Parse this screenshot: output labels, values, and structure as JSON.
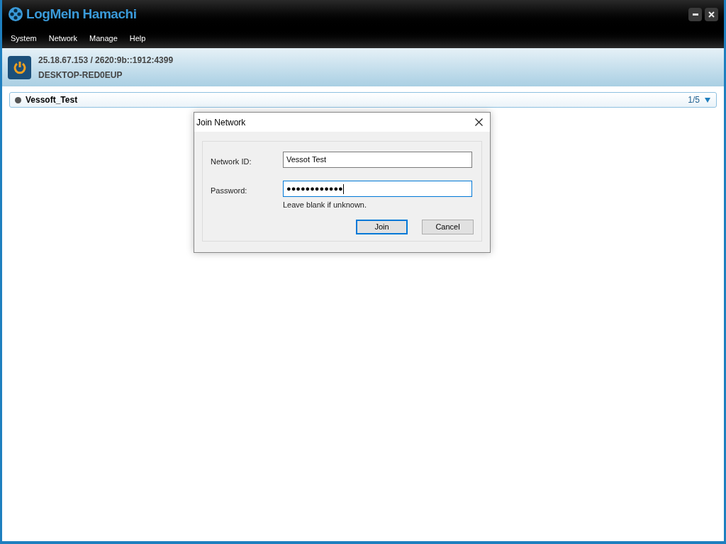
{
  "window": {
    "title": "LogMeIn Hamachi"
  },
  "menu": [
    "System",
    "Network",
    "Manage",
    "Help"
  ],
  "client": {
    "address": "25.18.67.153 / 2620:9b::1912:4399",
    "name": "DESKTOP-RED0EUP"
  },
  "networks": [
    {
      "name": "Vessoft_Test",
      "count": "1/5",
      "expanded": true
    }
  ],
  "dialog": {
    "title": "Join Network",
    "fields": [
      {
        "label": "Network ID:",
        "value": "Vessot Test",
        "focused": false
      },
      {
        "label": "Password:",
        "value": "●●●●●●●●●●●●",
        "focused": true,
        "hint": "Leave blank if unknown."
      }
    ],
    "buttons": [
      {
        "label": "Join",
        "default": true
      },
      {
        "label": "Cancel",
        "default": false
      }
    ]
  }
}
